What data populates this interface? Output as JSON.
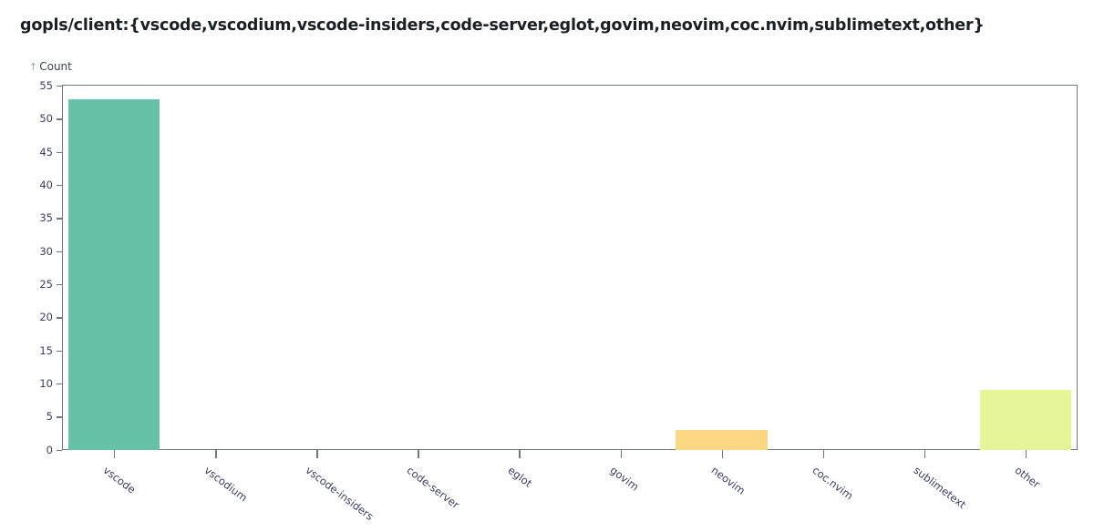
{
  "chart_data": {
    "type": "bar",
    "title": "gopls/client:{vscode,vscodium,vscode-insiders,code-server,eglot,govim,neovim,coc.nvim,sublimetext,other}",
    "xlabel": "",
    "ylabel": "Count",
    "ylim": [
      0,
      55
    ],
    "grid": false,
    "legend": "none",
    "y_axis_arrow": "↑",
    "categories": [
      "vscode",
      "vscodium",
      "vscode-insiders",
      "code-server",
      "eglot",
      "govim",
      "neovim",
      "coc.nvim",
      "sublimetext",
      "other"
    ],
    "values": [
      53,
      0,
      0,
      0,
      0,
      0,
      3,
      0,
      0,
      9
    ],
    "bar_colors": [
      "#66c2a5",
      "#66c2a5",
      "#66c2a5",
      "#66c2a5",
      "#66c2a5",
      "#66c2a5",
      "#fdd884",
      "#fdd884",
      "#e6f598",
      "#e6f598"
    ],
    "yticks": [
      0,
      5,
      10,
      15,
      20,
      25,
      30,
      35,
      40,
      45,
      50,
      55
    ],
    "ytick_labels": [
      "0",
      "5",
      "10",
      "15",
      "20",
      "25",
      "30",
      "35",
      "40",
      "45",
      "50",
      "55"
    ],
    "axis_color": "#70777f",
    "tick_text_color": "#3b3f63",
    "background_color": "#ffffff"
  }
}
